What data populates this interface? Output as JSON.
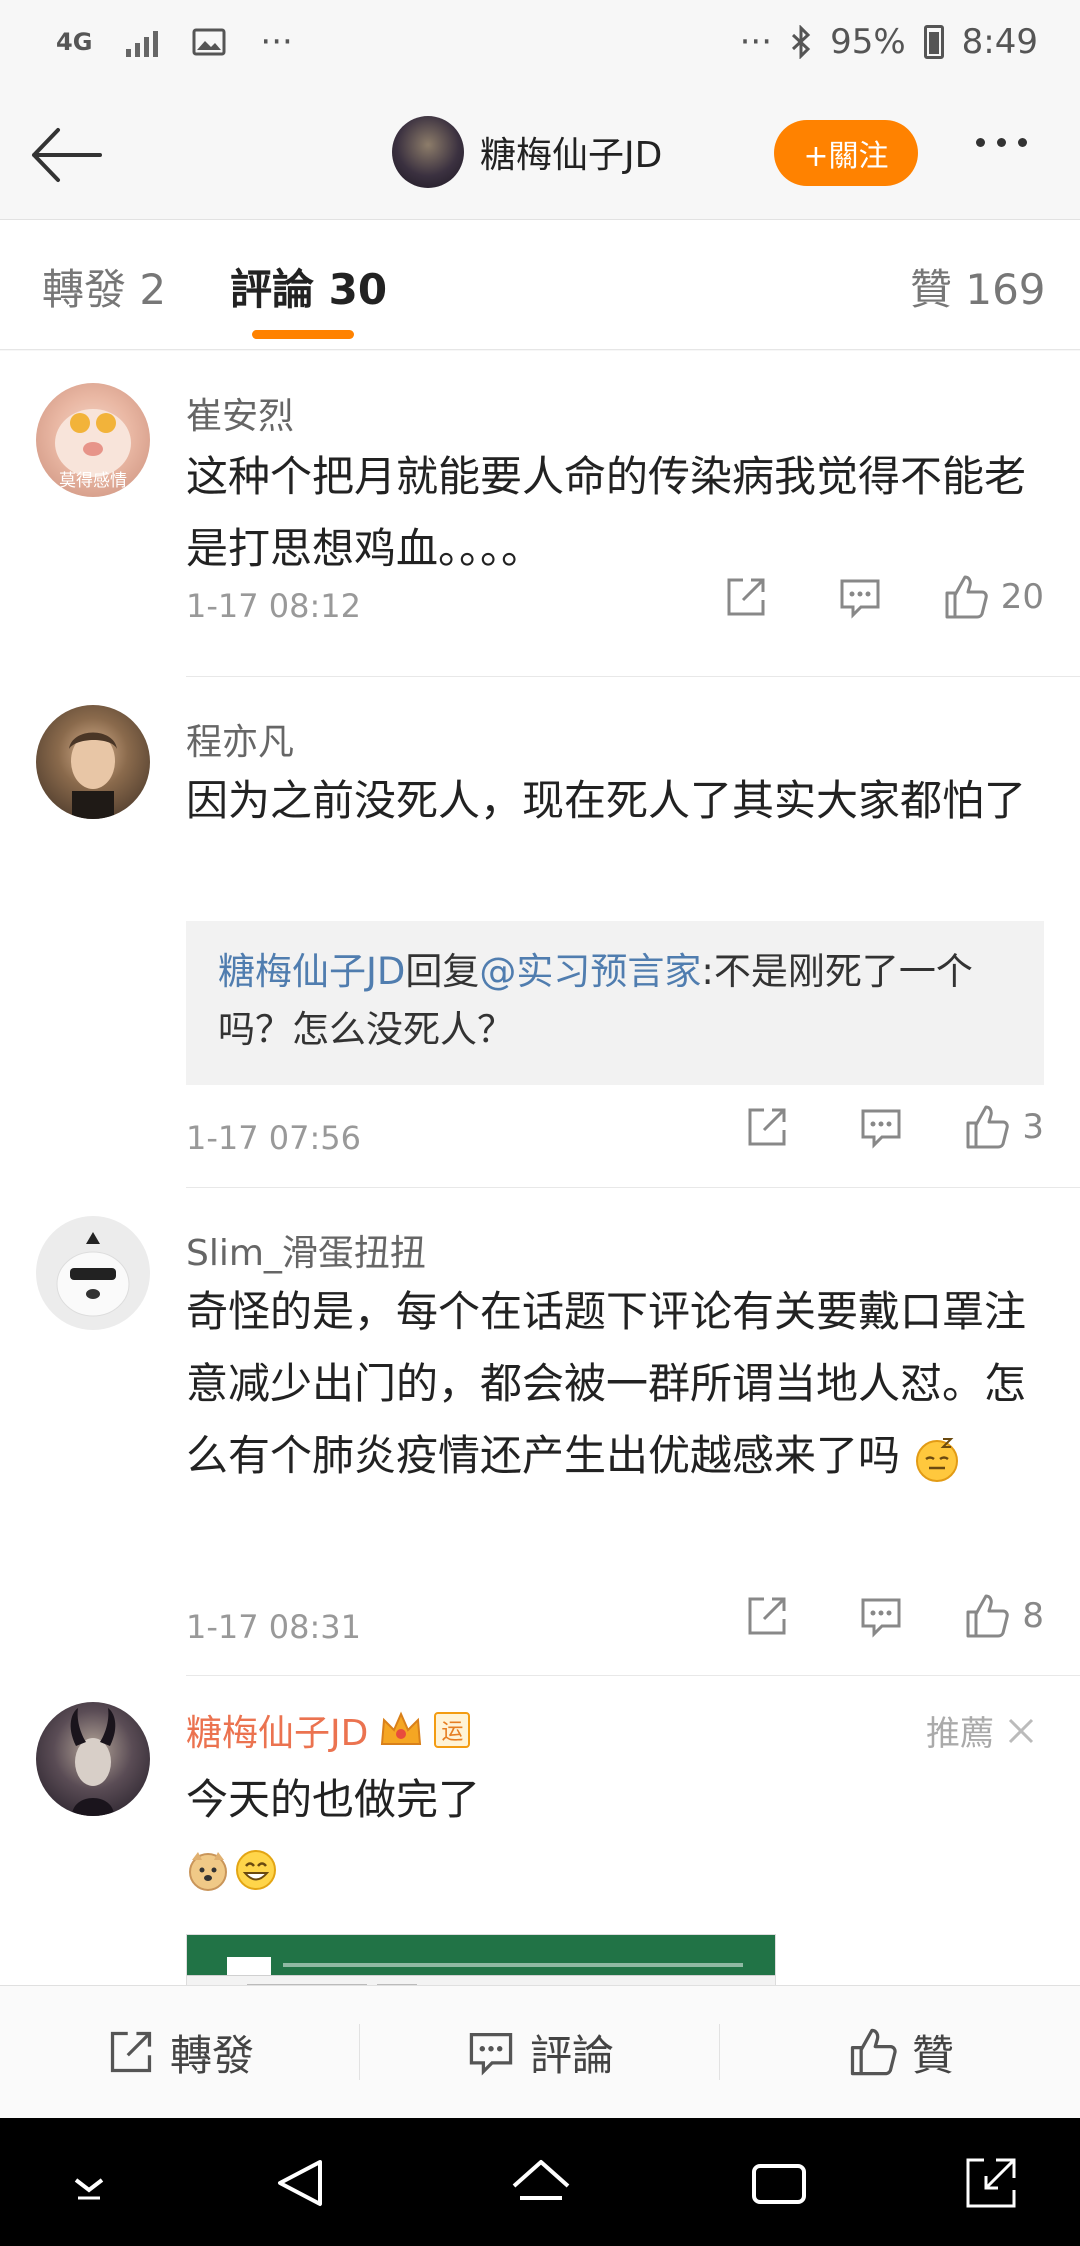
{
  "status_bar": {
    "network": "4G",
    "battery": "95%",
    "time": "8:49",
    "dots_left": "···",
    "dots_right": "···"
  },
  "header": {
    "author_name": "糖梅仙子JD",
    "follow_label": "+關注"
  },
  "tabs": {
    "repost": "轉發 2",
    "comment": "評論 30",
    "like": "贊 169"
  },
  "comments": [
    {
      "name": "崔安烈",
      "avatar_text": "莫得感情",
      "text": "这种个把月就能要人命的传染病我觉得不能老是打思想鸡血。。。。",
      "time": "1-17 08:12",
      "likes": "20"
    },
    {
      "name": "程亦凡",
      "text": "因为之前没死人，现在死人了其实大家都怕了",
      "reply": {
        "from": "糖梅仙子JD",
        "verb": "回复",
        "to": "@实习预言家",
        "text": ":不是刚死了一个吗？怎么没死人？"
      },
      "time": "1-17 07:56",
      "likes": "3"
    },
    {
      "name": "Slim_滑蛋扭扭",
      "text": "奇怪的是，每个在话题下评论有关要戴口罩注意减少出门的，都会被一群所谓当地人怼。怎么有个肺炎疫情还产生出优越感来了吗",
      "time": "1-17 08:31",
      "likes": "8"
    },
    {
      "name": "糖梅仙子JD",
      "text": "今天的也做完了",
      "recommend": "推薦",
      "badge_text": "运"
    }
  ],
  "bottom_bar": {
    "repost": "轉發",
    "comment": "評論",
    "like": "贊"
  },
  "colors": {
    "accent": "#ff8200",
    "link": "#507daf",
    "author_name": "#eb7350"
  }
}
